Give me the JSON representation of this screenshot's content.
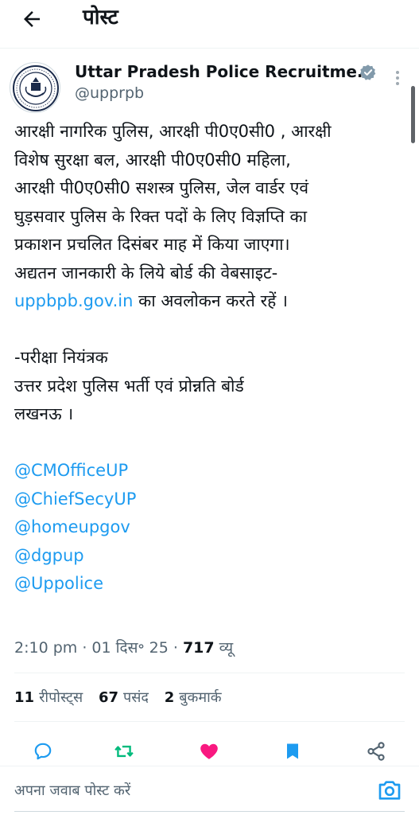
{
  "header": {
    "title": "पोस्ट"
  },
  "author": {
    "name": "Uttar Pradesh Police Recruitme...",
    "handle": "@upprpb"
  },
  "tweet": {
    "paragraph1_lines": [
      "आरक्षी नागरिक पुलिस, आरक्षी पी0ए0सी0 , आरक्षी",
      "विशेष सुरक्षा बल, आरक्षी पी0ए0सी0 महिला,",
      "आरक्षी पी0ए0सी0 सशस्त्र पुलिस, जेल वार्डर एवं",
      "घुड़सवार पुलिस के रिक्त पदों के लिए विज्ञप्ति का",
      "प्रकाशन प्रचलित दिसंबर माह में किया जाएगा।",
      "अद्यतन जानकारी के लिये बोर्ड की वेबसाइट-"
    ],
    "website_link": "uppbpb.gov.in",
    "website_suffix": " का अवलोकन करते रहें ।",
    "signature_lines": [
      "-परीक्षा नियंत्रक",
      "उत्तर प्रदेश पुलिस भर्ती एवं प्रोन्नति बोर्ड",
      "लखनऊ ।"
    ],
    "mentions": [
      "@CMOfficeUP",
      "@ChiefSecyUP",
      "@homeupgov",
      "@dgpup",
      "@Uppolice"
    ]
  },
  "meta": {
    "time": "2:10 pm",
    "date": "01 दिस॰ 25",
    "views_count": "717",
    "views_label": "व्यू"
  },
  "stats": {
    "reposts_count": "11",
    "reposts_label": "रीपोस्ट्स",
    "likes_count": "67",
    "likes_label": "पसंद",
    "bookmarks_count": "2",
    "bookmarks_label": "बुकमार्क"
  },
  "reply": {
    "placeholder": "अपना जवाब पोस्ट करें"
  },
  "colors": {
    "link": "#1d9bf0",
    "repost": "#00ba7c",
    "like": "#f91880",
    "bookmark": "#1d9bf0",
    "text": "#0f1419",
    "muted": "#536471"
  },
  "icons": {
    "back": "arrow-left-icon",
    "verified": "verified-badge-icon",
    "more": "more-vertical-icon",
    "reply": "reply-icon",
    "repost": "repost-icon",
    "like": "heart-icon",
    "bookmark": "bookmark-icon",
    "share": "share-icon",
    "camera": "camera-icon"
  }
}
